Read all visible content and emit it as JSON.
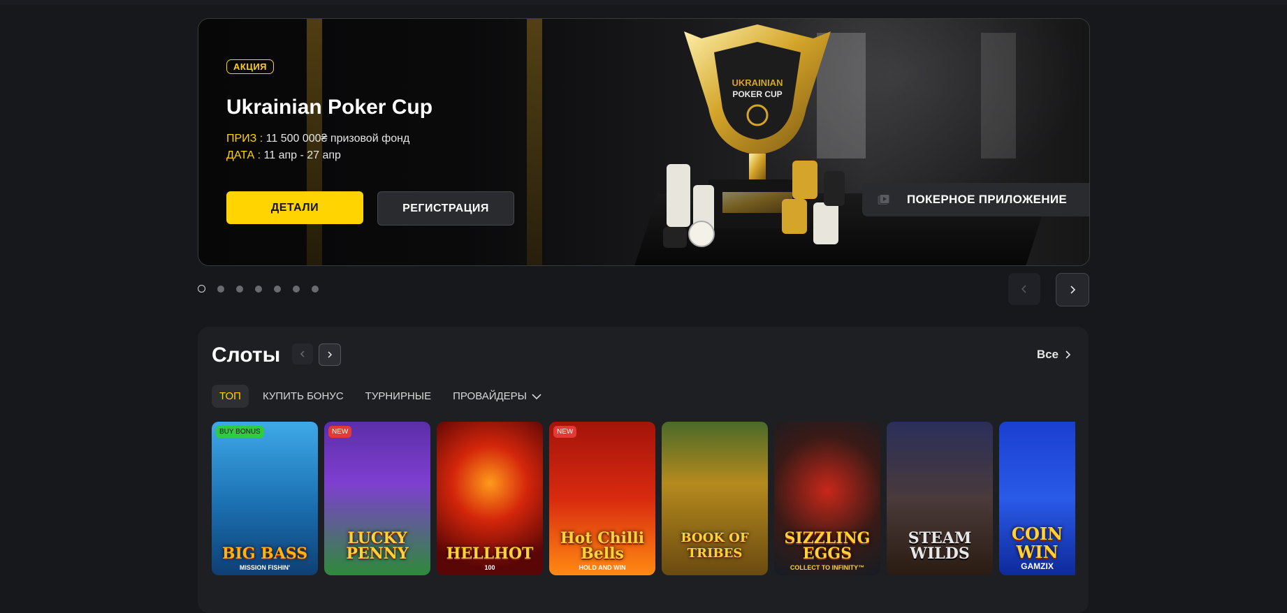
{
  "banner": {
    "tag": "АКЦИЯ",
    "title": "Ukrainian Poker Cup",
    "prize_label": "ПРИЗ :",
    "prize_value": " 11 500 000₴ призовой фонд",
    "date_label": "ДАТА :",
    "date_value": " 11 апр - 27 апр",
    "details_button": "ДЕТАЛИ",
    "register_button": "РЕГИСТРАЦИЯ",
    "app_button": "ПОКЕРНОЕ ПРИЛОЖЕНИЕ",
    "trophy_text_1": "UKRAINIAN",
    "trophy_text_2": "POKER CUP"
  },
  "carousel": {
    "slide_count": 7,
    "active_index": 0
  },
  "slots": {
    "title": "Слоты",
    "all_link": "Все",
    "tabs": [
      {
        "label": "ТОП",
        "active": true
      },
      {
        "label": "КУПИТЬ БОНУС",
        "active": false
      },
      {
        "label": "ТУРНИРНЫЕ",
        "active": false
      },
      {
        "label": "ПРОВАЙДЕРЫ",
        "active": false
      }
    ],
    "games": [
      {
        "name": "BIG BASS",
        "sub": "MISSION FISHIN'",
        "badge": "BUY BONUS"
      },
      {
        "name": "LUCKY PENNY",
        "sub": "",
        "badge": "NEW"
      },
      {
        "name": "HELLHOT",
        "sub": "100",
        "badge": ""
      },
      {
        "name": "Hot Chilli Bells",
        "sub": "HOLD AND WIN",
        "badge": "NEW"
      },
      {
        "name": "BOOK OF TRIBES",
        "sub": "",
        "badge": ""
      },
      {
        "name": "SIZZLING EGGS",
        "sub": "COLLECT TO INFINITY™",
        "badge": ""
      },
      {
        "name": "STEAM WILDS",
        "sub": "",
        "badge": ""
      },
      {
        "name": "COIN WIN",
        "sub": "GAMZIX",
        "badge": ""
      }
    ]
  },
  "colors": {
    "accent": "#ffd400",
    "background": "#17181c",
    "panel": "#1e1f23"
  }
}
